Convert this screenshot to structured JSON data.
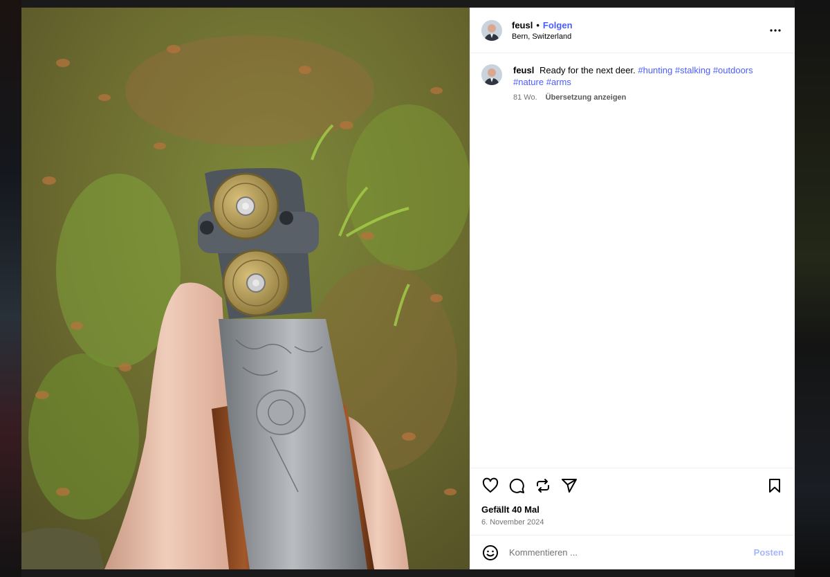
{
  "post": {
    "username": "feusl",
    "separator": "•",
    "follow_label": "Folgen",
    "location": "Bern, Switzerland",
    "caption": {
      "username": "feusl",
      "text": "Ready for the next deer.",
      "hashtags": [
        "#hunting",
        "#stalking",
        "#outdoors",
        "#nature",
        "#arms"
      ]
    },
    "age": "81 Wo.",
    "translate_label": "Übersetzung anzeigen",
    "likes": "Gefällt 40 Mal",
    "date": "6. November 2024"
  },
  "comment": {
    "placeholder": "Kommentieren ...",
    "post_label": "Posten"
  },
  "icons": {
    "more": "more-horizontal-icon",
    "like": "heart-icon",
    "comment": "comment-icon",
    "repost": "repost-icon",
    "share": "share-icon",
    "save": "bookmark-icon",
    "emoji": "emoji-icon"
  },
  "colors": {
    "link": "#4a5cff",
    "post_button": "#a5b6fb",
    "muted_text": "#737373"
  }
}
